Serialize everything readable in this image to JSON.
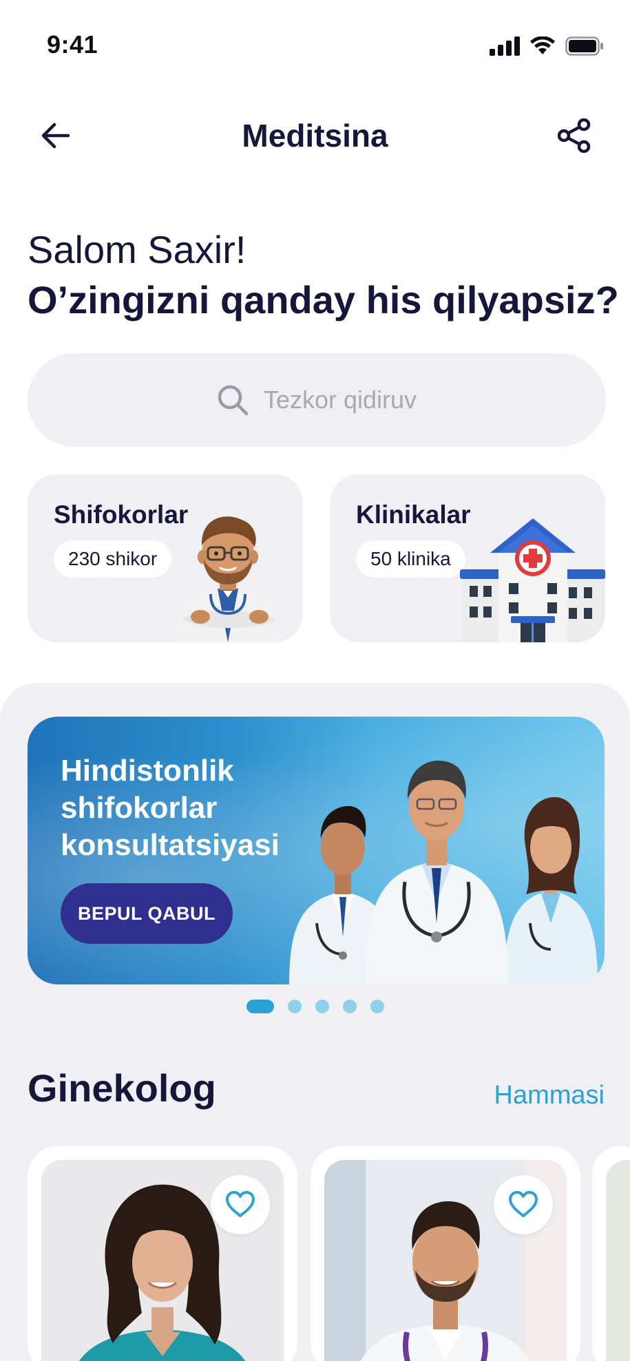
{
  "status_bar": {
    "time": "9:41"
  },
  "nav": {
    "title": "Meditsina"
  },
  "greeting": {
    "hello": "Salom Saxir!",
    "question": "O’zingizni qanday his qilyapsiz?"
  },
  "search": {
    "placeholder": "Tezkor qidiruv"
  },
  "categories": [
    {
      "title": "Shifokorlar",
      "count": "230 shikor",
      "icon": "doctor-cartoon-illustration"
    },
    {
      "title": "Klinikalar",
      "count": "50 klinika",
      "icon": "hospital-building-illustration"
    }
  ],
  "banner": {
    "title": "Hindistonlik shifokorlar konsultatsiyasi",
    "button_label": "BEPUL QABUL",
    "slides_total": 5,
    "active_slide": 1
  },
  "section": {
    "title": "Ginekolog",
    "see_all": "Hammasi"
  },
  "doctor_cards": [
    {
      "photo": "female-doctor-photo",
      "favorite_icon": "heart-outline-icon"
    },
    {
      "photo": "male-doctor-photo",
      "favorite_icon": "heart-outline-icon"
    }
  ],
  "colors": {
    "accent": "#2aa3d4",
    "primary_text": "#16163a",
    "button_dark": "#2f2f8f",
    "surface": "#f0f0f4"
  }
}
